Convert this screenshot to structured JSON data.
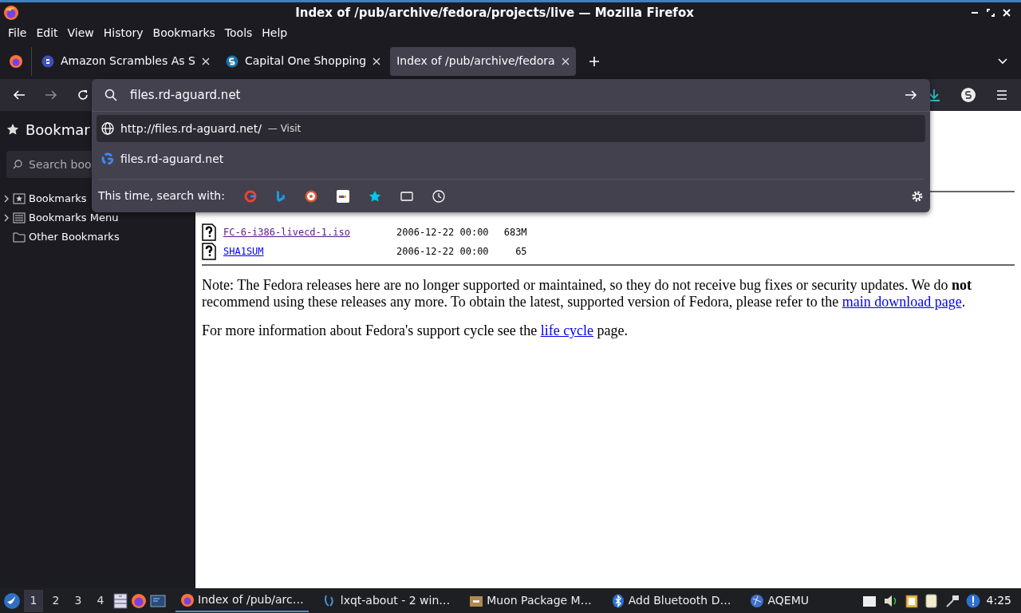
{
  "window": {
    "title": "Index of /pub/archive/fedora/projects/live — Mozilla Firefox"
  },
  "menu": [
    "File",
    "Edit",
    "View",
    "History",
    "Bookmarks",
    "Tools",
    "Help"
  ],
  "tabs": [
    {
      "label": "Amazon Scrambles As S",
      "selected": false
    },
    {
      "label": "Capital One Shopping",
      "selected": false
    },
    {
      "label": "Index of /pub/archive/fedora",
      "selected": true
    }
  ],
  "urlbar": {
    "value": "files.rd-aguard.net"
  },
  "suggestions": [
    {
      "kind": "visit",
      "text": "http://files.rd-aguard.net/",
      "action": "— Visit",
      "selected": true
    },
    {
      "kind": "search",
      "text": "files.rd-aguard.net",
      "selected": false
    }
  ],
  "search_with": {
    "label": "This time, search with:"
  },
  "sidebar": {
    "title": "Bookmar",
    "search_placeholder": "Search boo",
    "items": [
      {
        "label": "Bookmarks",
        "kind": "toolbar",
        "expandable": true
      },
      {
        "label": "Bookmarks Menu",
        "kind": "menu",
        "expandable": true
      },
      {
        "label": "Other Bookmarks",
        "kind": "folder",
        "expandable": false
      }
    ]
  },
  "page": {
    "files": [
      {
        "name": "FC-6-i386-livecd-1.iso",
        "date": "2006-12-22 00:00",
        "size": "683M",
        "visited": true
      },
      {
        "name": "SHA1SUM",
        "date": "2006-12-22 00:00",
        "size": "65",
        "visited": false
      }
    ],
    "paragraphs": [
      {
        "before": "Note: The Fedora releases here are no longer supported or maintained, so they do not receive bug fixes or security updates. We do **not** recommend using these releases any more. To obtain the latest, supported version of Fedora, please refer to the ",
        "link": "main download page",
        "after": "."
      },
      {
        "before": "For more information about Fedora's support cycle see the ",
        "link": "life cycle",
        "after": " page."
      }
    ]
  },
  "taskbar": {
    "desktops": [
      {
        "label": "1",
        "selected": true
      },
      {
        "label": "2",
        "selected": false
      },
      {
        "label": "3",
        "selected": false
      },
      {
        "label": "4",
        "selected": false
      }
    ],
    "tasks": [
      {
        "label": "Index of /pub/arc…",
        "selected": true
      },
      {
        "label": "lxqt-about - 2 win…",
        "selected": false
      },
      {
        "label": "Muon Package M…",
        "selected": false
      },
      {
        "label": "Add Bluetooth D…",
        "selected": false
      },
      {
        "label": "AQEMU",
        "selected": false
      }
    ],
    "clock": "4:25"
  }
}
